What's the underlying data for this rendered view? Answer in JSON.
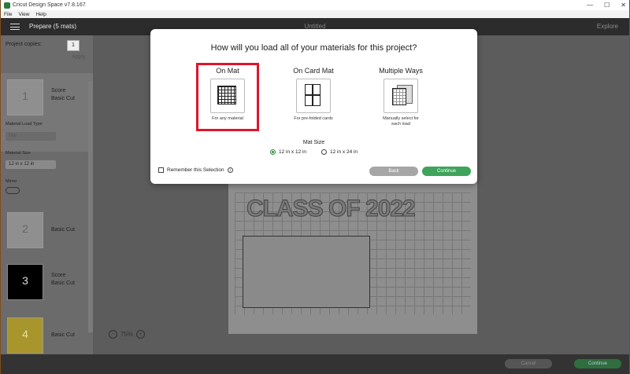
{
  "window": {
    "title": "Cricut Design Space  v7.8.167",
    "controls": [
      "—",
      "☐",
      "✕"
    ]
  },
  "menu": [
    "File",
    "View",
    "Help"
  ],
  "header": {
    "prepare": "Prepare (5 mats)",
    "document": "Untitled",
    "explore": "Explore"
  },
  "sidebar": {
    "copies_label": "Project copies:",
    "copies_value": "1",
    "apply": "Apply",
    "mats": [
      {
        "num": "1",
        "label1": "Score",
        "label2": "Basic Cut"
      },
      {
        "num": "2",
        "label1": "Basic Cut",
        "label2": ""
      },
      {
        "num": "3",
        "label1": "Score",
        "label2": "Basic Cut"
      },
      {
        "num": "4",
        "label1": "Basic Cut",
        "label2": ""
      }
    ],
    "material_load_type": "Material Load Type",
    "material_load_value": "Mat",
    "material_size": "Material Size",
    "material_size_value": "12 in x 12 in",
    "mirror": "Mirror"
  },
  "canvas": {
    "zoom": "75%",
    "mat_text": "CLASS OF 2022"
  },
  "footer": {
    "cancel": "Cancel",
    "continue": "Continue"
  },
  "dialog": {
    "title": "How will you load all of your materials for this project?",
    "options": [
      {
        "title": "On Mat",
        "caption": "For any material"
      },
      {
        "title": "On Card Mat",
        "caption": "For pre-folded cards"
      },
      {
        "title": "Multiple Ways",
        "caption": "Manually select for each load"
      }
    ],
    "mat_size_label": "Mat Size",
    "mat_size_options": [
      "12 in x 12 in",
      "12 in x 24 in"
    ],
    "remember": "Remember this Selection",
    "back": "Back",
    "continue": "Continue"
  },
  "colors": {
    "accent": "#3fa35b",
    "highlight": "#e0142b",
    "frame": "#7c4d1e"
  }
}
